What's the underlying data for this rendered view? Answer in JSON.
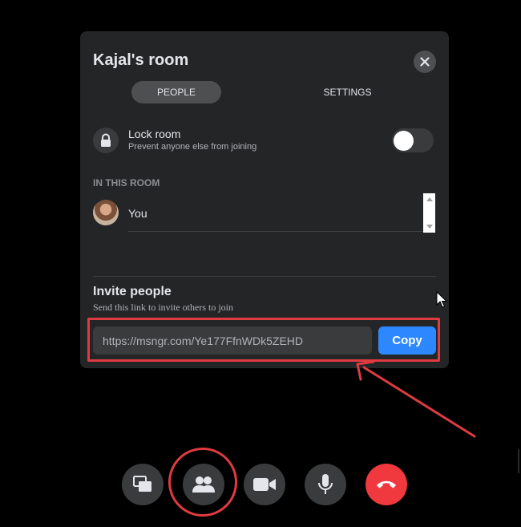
{
  "room": {
    "title": "Kajal's room",
    "tabs": [
      {
        "label": "PEOPLE",
        "active": true
      },
      {
        "label": "SETTINGS",
        "active": false
      }
    ]
  },
  "lock": {
    "title": "Lock room",
    "description": "Prevent anyone else from joining",
    "enabled": false
  },
  "participants": {
    "section_label": "IN THIS ROOM",
    "items": [
      {
        "name": "You",
        "avatar": "user-avatar"
      }
    ]
  },
  "invite": {
    "title": "Invite people",
    "description": "Send this link to invite others to join",
    "link": "https://msngr.com/Ye177FfnWDk5ZEHD",
    "copy_label": "Copy"
  },
  "controls": [
    {
      "icon": "share-screen-icon"
    },
    {
      "icon": "people-icon"
    },
    {
      "icon": "video-camera-icon"
    },
    {
      "icon": "microphone-icon"
    },
    {
      "icon": "hang-up-icon"
    }
  ],
  "colors": {
    "accent": "#2d88ff",
    "hangup": "#f0383f",
    "annotation": "#e03b40",
    "panel": "#242526"
  }
}
